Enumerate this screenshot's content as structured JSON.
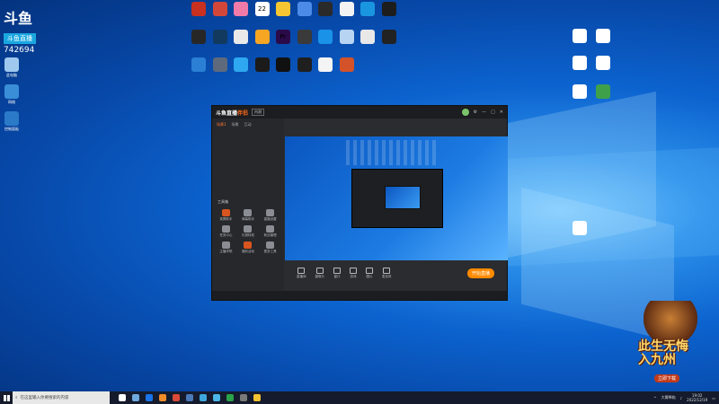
{
  "watermark": {
    "logo": "斗鱼",
    "badge": "斗鱼直播",
    "room": "742694"
  },
  "desktop_left_icons": [
    {
      "label": "此电脑",
      "color": "#9ec8ee"
    },
    {
      "label": "网络",
      "color": "#3a8ed8"
    },
    {
      "label": "控制面板",
      "color": "#2a7ac8"
    }
  ],
  "desktop_top_icons": [
    {
      "label": "",
      "color": "#c8301f"
    },
    {
      "label": "",
      "color": "#d2473a"
    },
    {
      "label": "",
      "color": "#f07aa8"
    },
    {
      "label": "22",
      "color": "#ffffff"
    },
    {
      "label": "",
      "color": "#f6c532"
    },
    {
      "label": "",
      "color": "#4c8be8"
    },
    {
      "label": "",
      "color": "#2a2a2a"
    },
    {
      "label": "",
      "color": "#f3f3f3"
    },
    {
      "label": "",
      "color": "#1a96e0"
    },
    {
      "label": "",
      "color": "#1d1d1d"
    },
    {
      "label": "",
      "color": "#272727"
    },
    {
      "label": "",
      "color": "#123a5e"
    },
    {
      "label": "",
      "color": "#e9e9e9"
    },
    {
      "label": "",
      "color": "#f6a623"
    },
    {
      "label": "Pr",
      "color": "#2b0a4a"
    },
    {
      "label": "",
      "color": "#3a3a3a"
    },
    {
      "label": "",
      "color": "#1992e8"
    },
    {
      "label": "",
      "color": "#b7d4f2"
    },
    {
      "label": "",
      "color": "#e8e8e8"
    },
    {
      "label": "",
      "color": "#222222"
    },
    {
      "label": "",
      "color": "#2b7fd4"
    },
    {
      "label": "",
      "color": "#5e6a7c"
    },
    {
      "label": "",
      "color": "#2ea8f0"
    },
    {
      "label": "",
      "color": "#1b1b1b"
    },
    {
      "label": "",
      "color": "#111111"
    },
    {
      "label": "",
      "color": "#1f1f1f"
    },
    {
      "label": "",
      "color": "#f4f4f4"
    },
    {
      "label": "",
      "color": "#d3522a"
    }
  ],
  "desktop_right_icons": [
    {
      "label": "",
      "color": "#ffffff"
    },
    {
      "label": "",
      "color": "#ffffff"
    },
    {
      "label": "",
      "color": "#ffffff"
    },
    {
      "label": "",
      "color": "#ffffff"
    },
    {
      "label": "",
      "color": "#ffffff"
    },
    {
      "label": "",
      "color": "#3fa04a"
    },
    {
      "label": "",
      "color": "#ffffff"
    }
  ],
  "app": {
    "logo": "斗鱼直播",
    "logo_accent": "伴侣",
    "version_tag": "内测",
    "side_tabs": [
      "场景1",
      "场景",
      "互动"
    ],
    "side_rows": [
      "",
      "",
      "",
      "",
      "",
      "",
      "",
      ""
    ],
    "tools_title": "工具箱",
    "tools": [
      {
        "label": "录屏助手",
        "orange": true
      },
      {
        "label": "弹幕助手",
        "orange": false
      },
      {
        "label": "直播设置",
        "orange": false
      },
      {
        "label": "任务中心",
        "orange": false
      },
      {
        "label": "礼物特效",
        "orange": false
      },
      {
        "label": "粉丝管理",
        "orange": false
      },
      {
        "label": "主播学院",
        "orange": false
      },
      {
        "label": "福利活动",
        "orange": true
      },
      {
        "label": "更多工具",
        "orange": false
      }
    ],
    "header_line1": "",
    "header_line2": "",
    "controls": [
      "直播间",
      "摄像头",
      "窗口",
      "游戏",
      "图片",
      "麦克风"
    ],
    "live_button": "开始直播",
    "status": ""
  },
  "promo": {
    "title_top": "此生无悔",
    "title_bottom": "入九州",
    "button": "立即下载"
  },
  "taskbar": {
    "search_placeholder": "在这里输入你要搜索的内容",
    "icons": [
      "#ffffff",
      "#6fa8dc",
      "#1a73e8",
      "#f28c28",
      "#d94a38",
      "#4a7ab8",
      "#3ea8dc",
      "#4ab7e8",
      "#2aa34a",
      "#7a7a7a",
      "#f1c232"
    ],
    "tray_text": "大雾降临",
    "time": "19:02",
    "date": "2022/12/19"
  }
}
